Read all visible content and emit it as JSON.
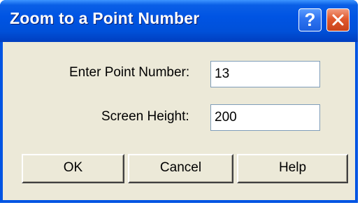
{
  "window": {
    "title": "Zoom to a Point Number",
    "help_button_glyph": "?",
    "close_icon": "close-icon"
  },
  "form": {
    "point_number_label": "Enter Point Number:",
    "point_number_value": "13",
    "screen_height_label": "Screen Height:",
    "screen_height_value": "200"
  },
  "buttons": {
    "ok_label": "OK",
    "cancel_label": "Cancel",
    "help_label": "Help"
  },
  "colors": {
    "titlebar": "#0054e3",
    "dialog_face": "#ece9d8",
    "close_button": "#e1592d"
  }
}
